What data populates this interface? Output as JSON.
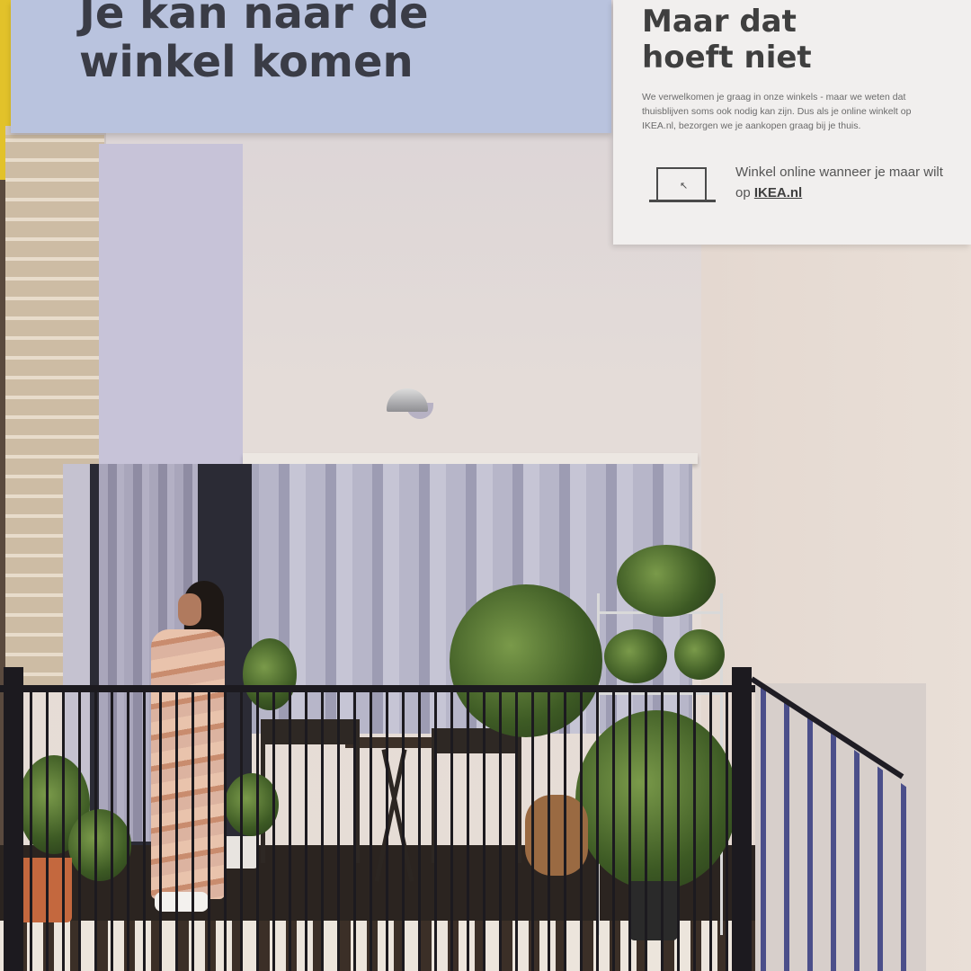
{
  "ad": {
    "headline_line1": "Je kan naar de",
    "headline_line2": "winkel komen",
    "card_title_line1": "Maar dat",
    "card_title_line2": "hoeft niet",
    "card_body": "We verwelkomen je graag in onze winkels - maar we weten dat thuisblijven soms ook nodig kan zijn. Dus als je online winkelt op IKEA.nl, bezorgen we je aankopen graag bij je thuis.",
    "shop_text": "Winkel online wanneer je maar wilt op",
    "shop_link": "IKEA.nl",
    "laptop_icon": "laptop-icon",
    "colors": {
      "top_strip": "#b9c3de",
      "card": "#f1efee",
      "text_dark": "#3a3c46",
      "accent_yellow": "#e2c22a"
    }
  }
}
